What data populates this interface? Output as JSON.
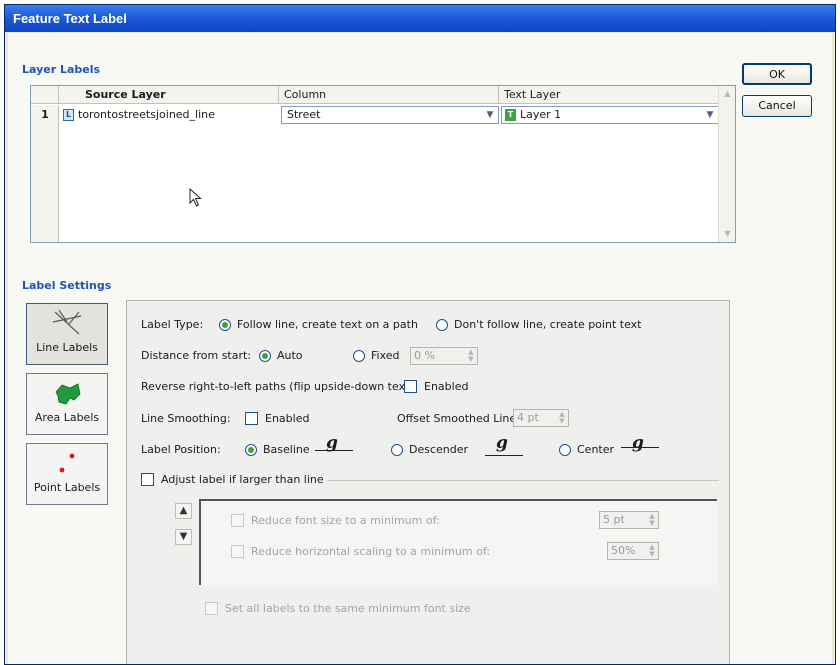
{
  "window": {
    "title": "Feature Text Label"
  },
  "buttons": {
    "ok": "OK",
    "cancel": "Cancel"
  },
  "layer_labels": {
    "heading": "Layer Labels",
    "columns": [
      "Source Layer",
      "Column",
      "Text Layer"
    ],
    "rows": [
      {
        "num": "1",
        "source_layer": "torontostreetsjoined_line",
        "column": "Street",
        "text_layer": "Layer 1"
      }
    ]
  },
  "label_settings": {
    "heading": "Label Settings",
    "tabs": [
      {
        "label": "Line Labels",
        "icon": "line-labels-icon",
        "active": true
      },
      {
        "label": "Area Labels",
        "icon": "area-labels-icon",
        "active": false
      },
      {
        "label": "Point Labels",
        "icon": "point-labels-icon",
        "active": false
      }
    ],
    "label_type": {
      "label": "Label Type:",
      "opt_follow": "Follow line, create text on a path",
      "opt_point": "Don't follow line, create point text",
      "selected": "follow"
    },
    "distance": {
      "label": "Distance from start:",
      "opt_auto": "Auto",
      "opt_fixed": "Fixed",
      "fixed_value": "0 %",
      "selected": "auto"
    },
    "reverse": {
      "label": "Reverse right-to-left paths (flip upside-down text):",
      "checkbox_label": "Enabled",
      "checked": false
    },
    "smoothing": {
      "label": "Line Smoothing:",
      "checkbox_label": "Enabled",
      "checked": false,
      "offset_label": "Offset Smoothed Line",
      "offset_value": "4 pt"
    },
    "position": {
      "label": "Label Position:",
      "opt_baseline": "Baseline",
      "opt_descender": "Descender",
      "opt_center": "Center",
      "glyph": "g",
      "selected": "baseline"
    },
    "adjust": {
      "label": "Adjust label if larger than line",
      "checked": false,
      "reduce_font_label": "Reduce font size to a minimum of:",
      "reduce_font_value": "5 pt",
      "reduce_scaling_label": "Reduce horizontal scaling to a minimum of:",
      "reduce_scaling_value": "50%",
      "same_size_label": "Set all labels to the same minimum font size"
    }
  }
}
